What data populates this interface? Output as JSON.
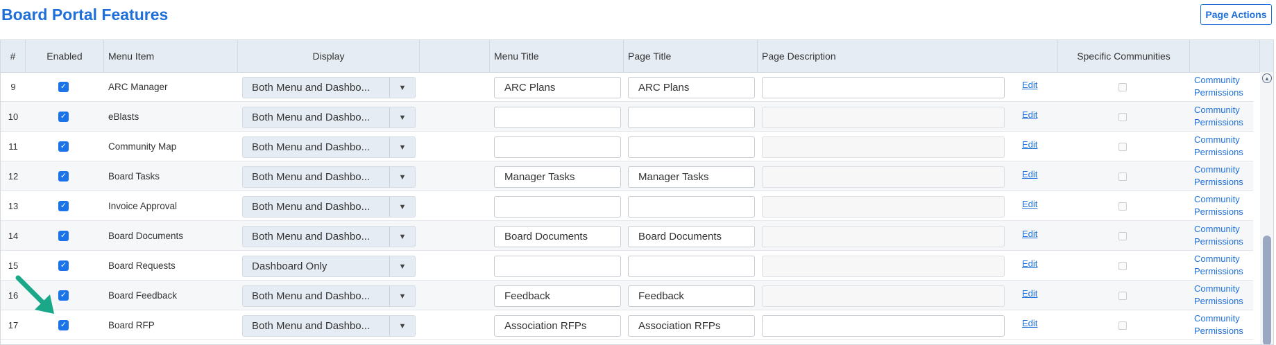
{
  "page": {
    "title": "Board Portal Features",
    "actions_label": "Page Actions"
  },
  "table": {
    "headers": {
      "num": "#",
      "enabled": "Enabled",
      "menu_item": "Menu Item",
      "display": "Display",
      "menu_title": "Menu Title",
      "page_title": "Page Title",
      "page_description": "Page Description",
      "specific_communities": "Specific Communities"
    },
    "rows": [
      {
        "num": "9",
        "menu_item": "ARC Manager",
        "display": "Both Menu and Dashbo...",
        "menu_title": "ARC Plans",
        "page_title": "ARC Plans",
        "page_description": "",
        "desc_enabled": true,
        "edit": "Edit",
        "permissions": "Community Permissions"
      },
      {
        "num": "10",
        "menu_item": "eBlasts",
        "display": "Both Menu and Dashbo...",
        "menu_title": "",
        "page_title": "",
        "page_description": "",
        "desc_enabled": false,
        "edit": "Edit",
        "permissions": "Community Permissions"
      },
      {
        "num": "11",
        "menu_item": "Community Map",
        "display": "Both Menu and Dashbo...",
        "menu_title": "",
        "page_title": "",
        "page_description": "",
        "desc_enabled": false,
        "edit": "Edit",
        "permissions": "Community Permissions"
      },
      {
        "num": "12",
        "menu_item": "Board Tasks",
        "display": "Both Menu and Dashbo...",
        "menu_title": "Manager Tasks",
        "page_title": "Manager Tasks",
        "page_description": "",
        "desc_enabled": false,
        "edit": "Edit",
        "permissions": "Community Permissions"
      },
      {
        "num": "13",
        "menu_item": "Invoice Approval",
        "display": "Both Menu and Dashbo...",
        "menu_title": "",
        "page_title": "",
        "page_description": "",
        "desc_enabled": false,
        "edit": "Edit",
        "permissions": "Community Permissions"
      },
      {
        "num": "14",
        "menu_item": "Board Documents",
        "display": "Both Menu and Dashbo...",
        "menu_title": "Board Documents",
        "page_title": "Board Documents",
        "page_description": "",
        "desc_enabled": false,
        "edit": "Edit",
        "permissions": "Community Permissions"
      },
      {
        "num": "15",
        "menu_item": "Board Requests",
        "display": "Dashboard Only",
        "menu_title": "",
        "page_title": "",
        "page_description": "",
        "desc_enabled": false,
        "edit": "Edit",
        "permissions": "Community Permissions"
      },
      {
        "num": "16",
        "menu_item": "Board Feedback",
        "display": "Both Menu and Dashbo...",
        "menu_title": "Feedback",
        "page_title": "Feedback",
        "page_description": "",
        "desc_enabled": false,
        "edit": "Edit",
        "permissions": "Community Permissions"
      },
      {
        "num": "17",
        "menu_item": "Board RFP",
        "display": "Both Menu and Dashbo...",
        "menu_title": "Association RFPs",
        "page_title": "Association RFPs",
        "page_description": "",
        "desc_enabled": true,
        "edit": "Edit",
        "permissions": "Community Permissions"
      }
    ]
  },
  "icons": {
    "enabled_checkbox": "checkbox-checked-icon",
    "dropdown": "chevron-down-icon",
    "scroll_up": "chevron-up-icon",
    "annotation": "arrow-pointer-icon"
  },
  "colors": {
    "accent": "#1e6fd9",
    "checkbox": "#1a73e8",
    "header_bg": "#e6ecf3",
    "annotation_arrow": "#1aa889"
  }
}
